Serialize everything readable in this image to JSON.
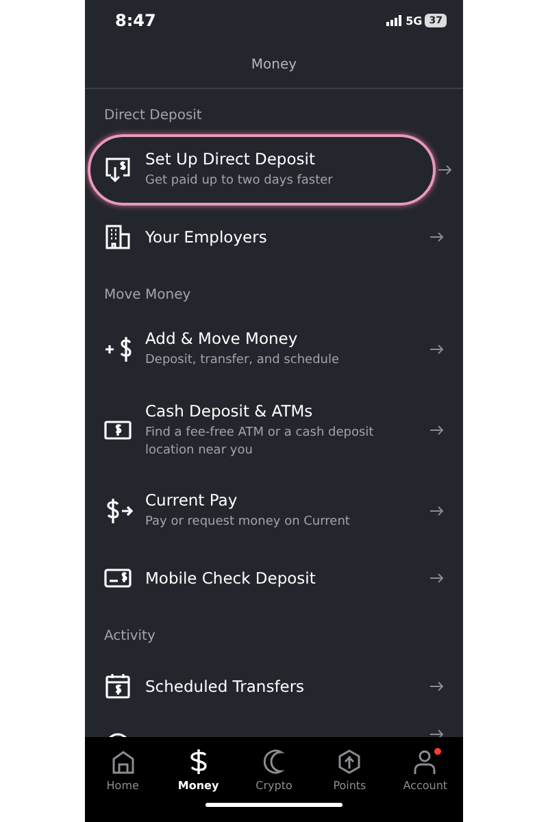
{
  "status_bar": {
    "time": "8:47",
    "network": "5G",
    "battery": "37"
  },
  "header": {
    "title": "Money"
  },
  "sections": [
    {
      "label": "Direct Deposit",
      "items": [
        {
          "kind": "deposit",
          "title": "Set Up Direct Deposit",
          "subtitle": "Get paid up to two days faster",
          "highlighted": true
        },
        {
          "kind": "building",
          "title": "Your Employers",
          "highlighted": false
        }
      ]
    },
    {
      "label": "Move Money",
      "items": [
        {
          "kind": "plus-dollar",
          "title": "Add & Move Money",
          "subtitle": "Deposit, transfer, and schedule",
          "highlighted": false
        },
        {
          "kind": "cash",
          "title": "Cash Deposit & ATMs",
          "subtitle": "Find a fee-free ATM or a cash deposit location near you",
          "highlighted": false
        },
        {
          "kind": "dollar-arrow",
          "title": "Current Pay",
          "subtitle": "Pay or request money on Current",
          "highlighted": false
        },
        {
          "kind": "check",
          "title": "Mobile Check Deposit",
          "highlighted": false
        }
      ]
    },
    {
      "label": "Activity",
      "items": [
        {
          "kind": "calendar",
          "title": "Scheduled Transfers",
          "highlighted": false
        },
        {
          "kind": "clock",
          "highlighted": false
        }
      ]
    }
  ],
  "tabs": [
    {
      "kind": "home",
      "label": "Home",
      "selected": false,
      "badge": false
    },
    {
      "kind": "dollar",
      "label": "Money",
      "selected": true,
      "badge": false
    },
    {
      "kind": "moon",
      "label": "Crypto",
      "selected": false,
      "badge": false
    },
    {
      "kind": "gem",
      "label": "Points",
      "selected": false,
      "badge": false
    },
    {
      "kind": "person",
      "label": "Account",
      "selected": false,
      "badge": true
    }
  ]
}
